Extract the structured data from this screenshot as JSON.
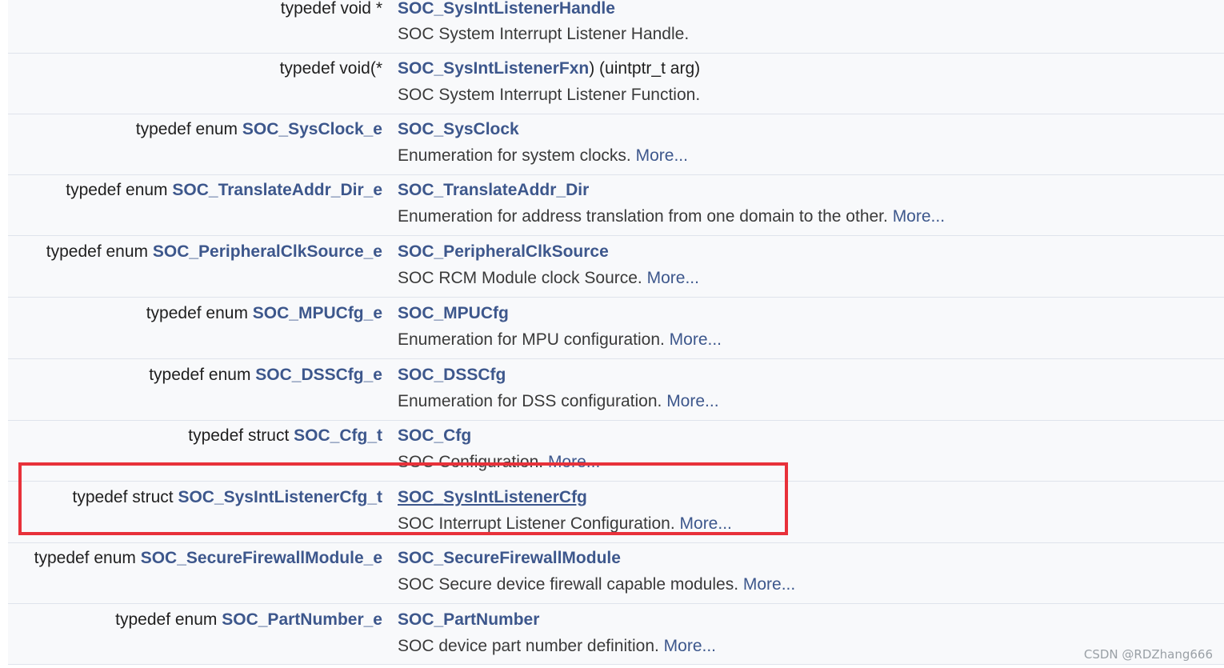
{
  "rows": [
    {
      "left_prefix": "typedef void *",
      "left_link": "",
      "member": "SOC_SysIntListenerHandle",
      "member_suffix": "",
      "desc": "SOC System Interrupt Listener Handle.",
      "more": ""
    },
    {
      "left_prefix": "typedef void(*",
      "left_link": "",
      "member": "SOC_SysIntListenerFxn",
      "member_suffix": ") (uintptr_t arg)",
      "desc": "SOC System Interrupt Listener Function.",
      "more": ""
    },
    {
      "left_prefix": "typedef enum ",
      "left_link": "SOC_SysClock_e",
      "member": "SOC_SysClock",
      "member_suffix": "",
      "desc": "Enumeration for system clocks. ",
      "more": "More..."
    },
    {
      "left_prefix": "typedef enum ",
      "left_link": "SOC_TranslateAddr_Dir_e",
      "member": "SOC_TranslateAddr_Dir",
      "member_suffix": "",
      "desc": "Enumeration for address translation from one domain to the other. ",
      "more": "More..."
    },
    {
      "left_prefix": "typedef enum ",
      "left_link": "SOC_PeripheralClkSource_e",
      "member": "SOC_PeripheralClkSource",
      "member_suffix": "",
      "desc": "SOC RCM Module clock Source. ",
      "more": "More..."
    },
    {
      "left_prefix": "typedef enum ",
      "left_link": "SOC_MPUCfg_e",
      "member": "SOC_MPUCfg",
      "member_suffix": "",
      "desc": "Enumeration for MPU configuration. ",
      "more": "More..."
    },
    {
      "left_prefix": "typedef enum ",
      "left_link": "SOC_DSSCfg_e",
      "member": "SOC_DSSCfg",
      "member_suffix": "",
      "desc": "Enumeration for DSS configuration. ",
      "more": "More..."
    },
    {
      "left_prefix": "typedef struct ",
      "left_link": "SOC_Cfg_t",
      "member": "SOC_Cfg",
      "member_suffix": "",
      "desc": "SOC Configuration. ",
      "more": "More..."
    },
    {
      "left_prefix": "typedef struct ",
      "left_link": "SOC_SysIntListenerCfg_t",
      "member": "SOC_SysIntListenerCfg",
      "member_suffix": "",
      "desc": "SOC Interrupt Listener Configuration. ",
      "more": "More..."
    },
    {
      "left_prefix": "typedef enum ",
      "left_link": "SOC_SecureFirewallModule_e",
      "member": "SOC_SecureFirewallModule",
      "member_suffix": "",
      "desc": "SOC Secure device firewall capable modules. ",
      "more": "More..."
    },
    {
      "left_prefix": "typedef enum ",
      "left_link": "SOC_PartNumber_e",
      "member": "SOC_PartNumber",
      "member_suffix": "",
      "desc": "SOC device part number definition. ",
      "more": "More..."
    }
  ],
  "watermark": "CSDN @RDZhang666",
  "colors": {
    "link": "#3d578c",
    "row_bg": "#f8f9fb",
    "separator": "#dfe3ec",
    "highlight": "#e8313a"
  }
}
